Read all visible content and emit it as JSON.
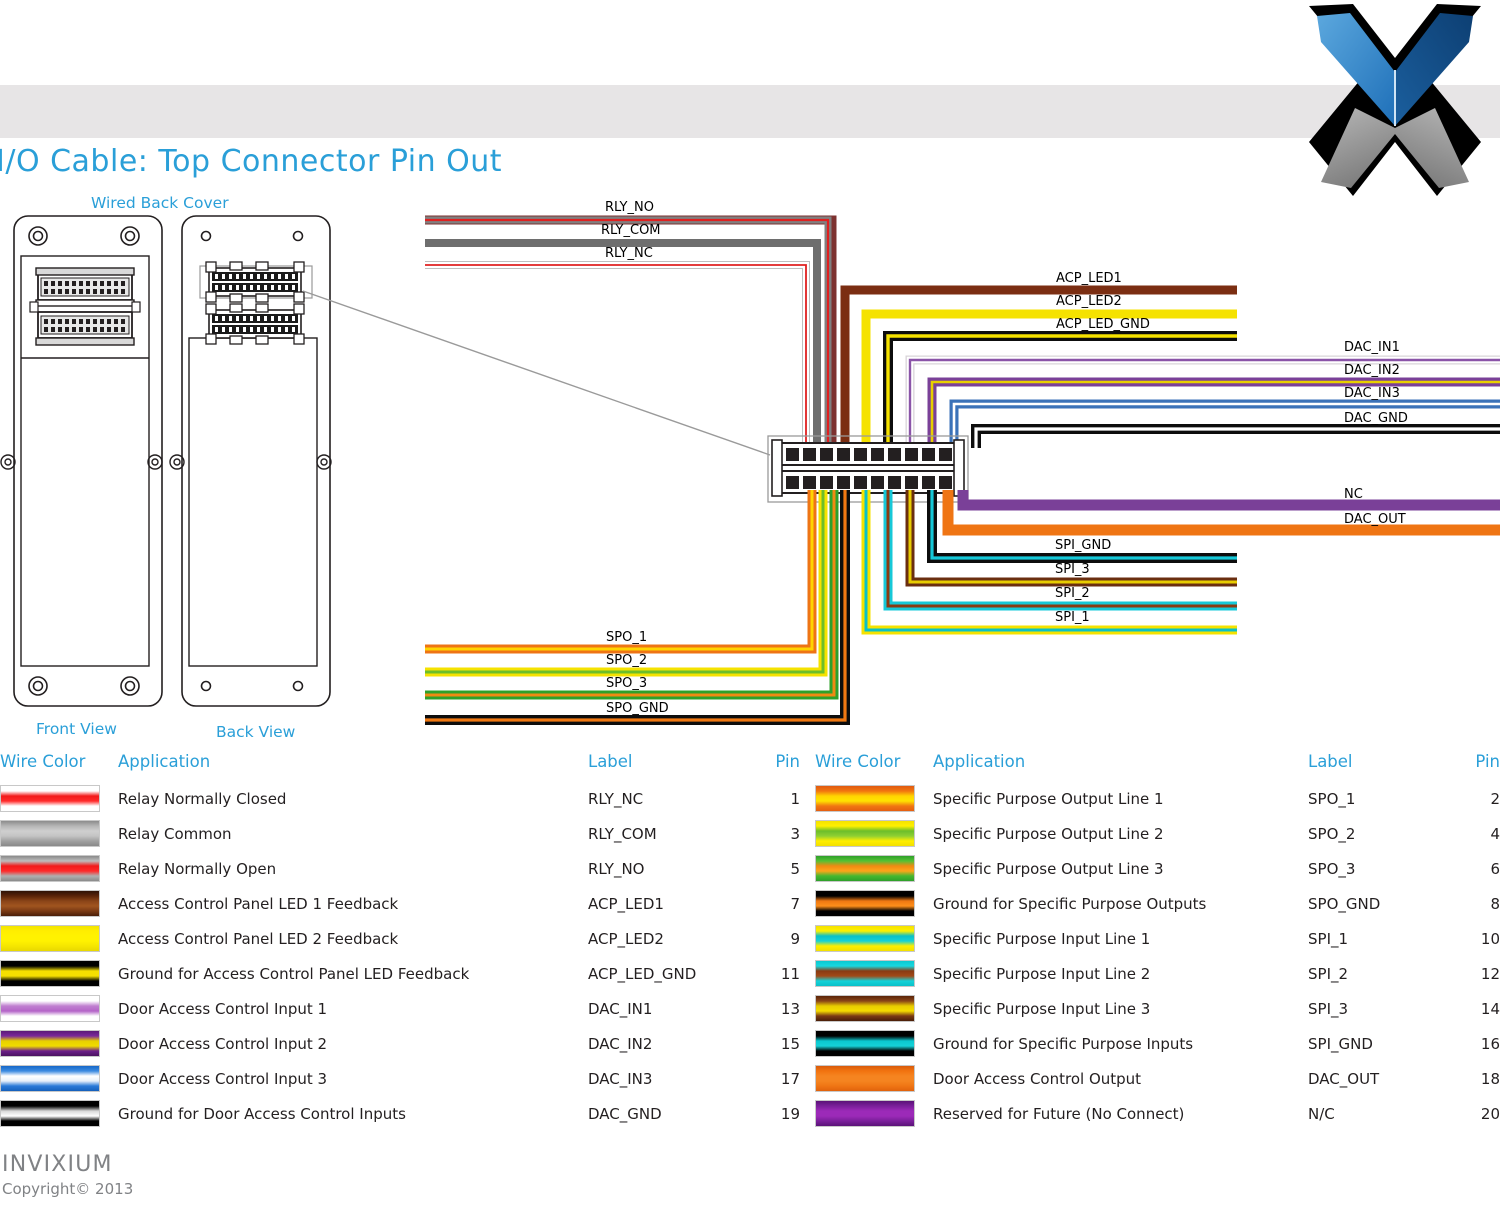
{
  "page": {
    "title": "I/O Cable: Top Connector Pin Out",
    "accent_color": "#2a9fd8",
    "header_band_color": "#e7e5e6"
  },
  "logo": {
    "name": "invixium-x-logo"
  },
  "device": {
    "caption": "Wired Back Cover",
    "front_view_label": "Front View",
    "back_view_label": "Back View"
  },
  "wire_callouts": {
    "left_top": [
      "RLY_NO",
      "RLY_COM",
      "RLY_NC"
    ],
    "mid_top": [
      "ACP_LED1",
      "ACP_LED2",
      "ACP_LED_GND"
    ],
    "right_top": [
      "DAC_IN1",
      "DAC_IN2",
      "DAC_IN3",
      "DAC_GND"
    ],
    "right_bottom": [
      "NC",
      "DAC_OUT"
    ],
    "mid_bottom": [
      "SPI_GND",
      "SPI_3",
      "SPI_2",
      "SPI_1"
    ],
    "left_bottom": [
      "SPO_1",
      "SPO_2",
      "SPO_3",
      "SPO_GND"
    ]
  },
  "tables": {
    "headers": {
      "wire_color": "Wire Color",
      "application": "Application",
      "label": "Label",
      "pin": "Pin"
    },
    "left_rows": [
      {
        "application": "Relay Normally Closed",
        "label": "RLY_NC",
        "pin": "1",
        "colors": [
          "#ffffff",
          "#ffffff",
          "#f21a1a",
          "#ff2a2a",
          "#ffffff",
          "#ffffff"
        ]
      },
      {
        "application": "Relay Common",
        "label": "RLY_COM",
        "pin": "3",
        "colors": [
          "#8c8c8c",
          "#b5b5b5",
          "#cfcfcf",
          "#c4c4c4",
          "#a0a0a0",
          "#8a8a8a"
        ]
      },
      {
        "application": "Relay Normally Open",
        "label": "RLY_NO",
        "pin": "5",
        "colors": [
          "#8a8a8a",
          "#bdbdbd",
          "#f21a1a",
          "#ff2a2a",
          "#b0b0b0",
          "#8a8a8a"
        ]
      },
      {
        "application": "Access Control Panel LED 1 Feedback",
        "label": "ACP_LED1",
        "pin": "7",
        "colors": [
          "#2e1206",
          "#5a2409",
          "#8a4418",
          "#a0551f",
          "#7a3a14",
          "#4a1e08"
        ]
      },
      {
        "application": "Access Control Panel LED 2 Feedback",
        "label": "ACP_LED2",
        "pin": "9",
        "colors": [
          "#f2e400",
          "#ffee00",
          "#fff200",
          "#fff200",
          "#f5e600",
          "#e8d800"
        ]
      },
      {
        "application": "Ground for Access Control Panel LED Feedback",
        "label": "ACP_LED_GND",
        "pin": "11",
        "colors": [
          "#000000",
          "#000000",
          "#f5e000",
          "#f5e000",
          "#000000",
          "#000000"
        ]
      },
      {
        "application": "Door Access Control Input 1",
        "label": "DAC_IN1",
        "pin": "13",
        "colors": [
          "#ffffff",
          "#ffffff",
          "#c07fd0",
          "#b464c8",
          "#ffffff",
          "#ffffff"
        ]
      },
      {
        "application": "Door Access Control Input 2",
        "label": "DAC_IN2",
        "pin": "15",
        "colors": [
          "#5b1a78",
          "#7a2a9a",
          "#e8d000",
          "#f0dc00",
          "#6b1f88",
          "#4a1260"
        ]
      },
      {
        "application": "Door Access Control Input 3",
        "label": "DAC_IN3",
        "pin": "17",
        "colors": [
          "#1668c8",
          "#3b8ae0",
          "#ffffff",
          "#e8f0fa",
          "#2a7ad8",
          "#1560bb"
        ]
      },
      {
        "application": "Ground for Door Access Control Inputs",
        "label": "DAC_GND",
        "pin": "19",
        "colors": [
          "#000000",
          "#000000",
          "#d8d8d8",
          "#ffffff",
          "#000000",
          "#000000"
        ]
      }
    ],
    "right_rows": [
      {
        "application": "Specific Purpose Output Line 1",
        "label": "SPO_1",
        "pin": "2",
        "colors": [
          "#e05a10",
          "#f2750f",
          "#ffd400",
          "#ffe400",
          "#f07812",
          "#e55f10"
        ]
      },
      {
        "application": "Specific Purpose Output Line 2",
        "label": "SPO_2",
        "pin": "4",
        "colors": [
          "#f5e200",
          "#fff000",
          "#6cbe2a",
          "#8ed033",
          "#ffee00",
          "#f2e000"
        ]
      },
      {
        "application": "Specific Purpose Output Line 3",
        "label": "SPO_3",
        "pin": "6",
        "colors": [
          "#2ea02a",
          "#54c234",
          "#f08a12",
          "#ffa51a",
          "#46b830",
          "#2ea02a"
        ]
      },
      {
        "application": "Ground for Specific Purpose Outputs",
        "label": "SPO_GND",
        "pin": "8",
        "colors": [
          "#000000",
          "#000000",
          "#f07812",
          "#ff8f1a",
          "#000000",
          "#000000"
        ]
      },
      {
        "application": "Specific Purpose Input Line 1",
        "label": "SPI_1",
        "pin": "10",
        "colors": [
          "#f5e200",
          "#fff000",
          "#0ac0c8",
          "#16d2d8",
          "#ffee00",
          "#f2e000"
        ]
      },
      {
        "application": "Specific Purpose Input Line 2",
        "label": "SPI_2",
        "pin": "12",
        "colors": [
          "#0ac8d0",
          "#1ad8e0",
          "#8a3a12",
          "#a04a18",
          "#16d2d8",
          "#0ac0c8"
        ]
      },
      {
        "application": "Specific Purpose Input Line 3",
        "label": "SPI_3",
        "pin": "14",
        "colors": [
          "#5a2409",
          "#8a4418",
          "#e8cc00",
          "#f5dc00",
          "#7a3a14",
          "#4a1e08"
        ]
      },
      {
        "application": "Ground for Specific Purpose Inputs",
        "label": "SPI_GND",
        "pin": "16",
        "colors": [
          "#000000",
          "#000000",
          "#0ac8d0",
          "#16d2d8",
          "#000000",
          "#000000"
        ]
      },
      {
        "application": "Door Access Control Output",
        "label": "DAC_OUT",
        "pin": "18",
        "colors": [
          "#d85a0a",
          "#f2730f",
          "#f58420",
          "#f58420",
          "#ef7514",
          "#e0620c"
        ]
      },
      {
        "application": "Reserved for Future (No Connect)",
        "label": "N/C",
        "pin": "20",
        "colors": [
          "#5b1278",
          "#7a1f9a",
          "#9c2ab8",
          "#9c2ab8",
          "#7a1f9a",
          "#5b1278"
        ]
      }
    ]
  },
  "footer": {
    "brand": "INVIXIUM",
    "copyright": "Copyright© 2013"
  }
}
